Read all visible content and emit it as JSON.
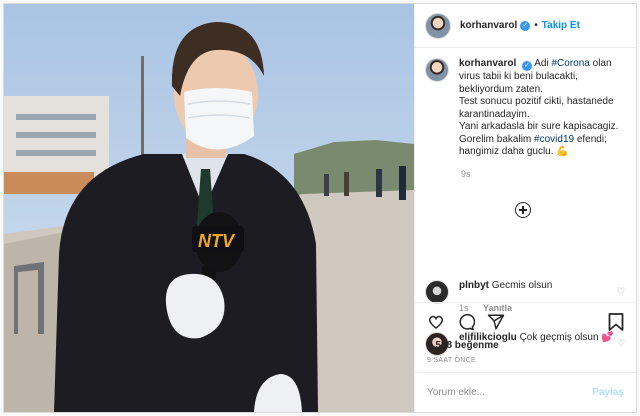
{
  "post": {
    "username": "korhanvarol",
    "verified_glyph": "✓",
    "separator": "•",
    "follow_label": "Takip Et"
  },
  "caption": {
    "username": "korhanvarol",
    "pre": "Adi ",
    "hashtag1": "#Corona",
    "mid1": " olan virus tabii ki beni bulacakti, bekliyordum zaten.",
    "line2": "Test sonucu pozitif cikti, hastanede karantinadayim.",
    "line3": "Yani arkadasla bir sure kapisacagiz.",
    "pre4": "Gorelim bakalim ",
    "hashtag2": "#covid19",
    "post4": " efendi; hangimiz daha guclu. 💪",
    "age": "9s"
  },
  "comments": [
    {
      "username": "plnbyt",
      "text": "Gecmis olsun",
      "age": "1s",
      "reply": "Yanıtla"
    },
    {
      "username": "elifilikcioglu",
      "text": "Çok geçmiş olsun 💕"
    }
  ],
  "likes": "5.588 beğenme",
  "timestamp": "9 SAAT ÖNCE",
  "add_comment": {
    "placeholder": "Yorum ekle...",
    "share_label": "Paylaş"
  },
  "image": {
    "logo_text": "NTV"
  },
  "colors": {
    "link": "#0095f6",
    "hashtag": "#00376b",
    "verified": "#3897f0",
    "muted": "#8e8e8e"
  }
}
